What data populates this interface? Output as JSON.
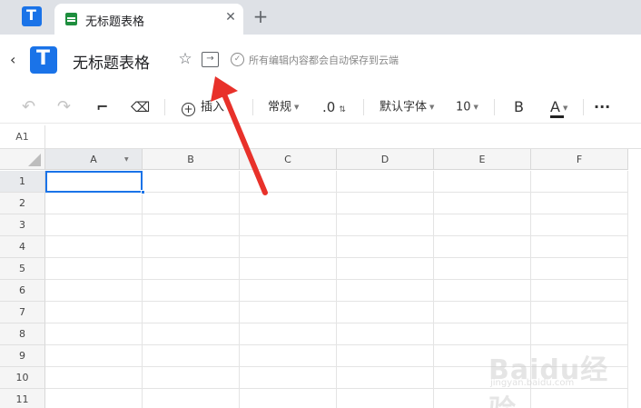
{
  "tabbar": {
    "tab_title": "无标题表格",
    "close_glyph": "✕",
    "new_tab_glyph": "+"
  },
  "header": {
    "back_glyph": "‹",
    "title": "无标题表格",
    "star_glyph": "☆",
    "move_glyph": "→",
    "save_glyph": "✓",
    "save_status": "所有编辑内容都会自动保存到云端"
  },
  "toolbar": {
    "undo_glyph": "↶",
    "redo_glyph": "↷",
    "format_painter_glyph": "⌐",
    "eraser_glyph": "⌫",
    "insert_label": "插入",
    "number_format": "常规",
    "decimal_label": ".0",
    "font_family": "默认字体",
    "font_size": "10",
    "bold_label": "B",
    "font_color_label": "A",
    "more_glyph": "···"
  },
  "sheet": {
    "name_box": "A1",
    "columns": [
      "A",
      "B",
      "C",
      "D",
      "E",
      "F"
    ],
    "rows": [
      "1",
      "2",
      "3",
      "4",
      "5",
      "6",
      "7",
      "8",
      "9",
      "10",
      "11"
    ],
    "selected_cell": "A1"
  },
  "colors": {
    "accent": "#1a73e8",
    "sheet_icon": "#1e8e3e",
    "annotation_arrow": "#e8312a"
  },
  "watermark": {
    "brand": "Baidu经验",
    "url": "jingyan.baidu.com"
  }
}
